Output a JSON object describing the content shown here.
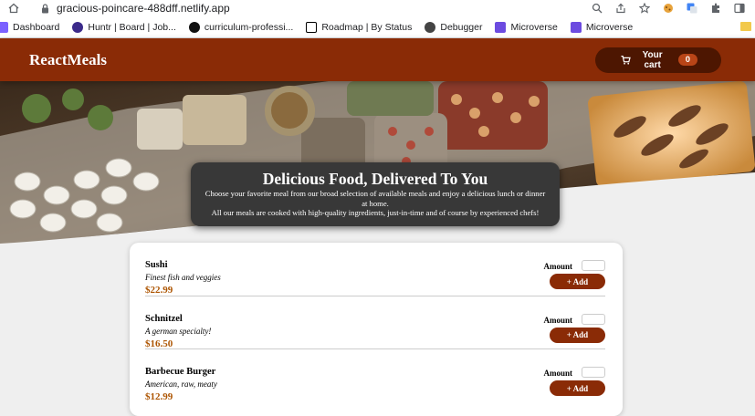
{
  "browser": {
    "url": "gracious-poincare-488dff.netlify.app",
    "bookmarks": [
      {
        "label": "Dashboard",
        "color": "#7b61ff"
      },
      {
        "label": "Huntr | Board | Job...",
        "color": "#3b2a8a"
      },
      {
        "label": "curriculum-professi...",
        "color": "#111111"
      },
      {
        "label": "Roadmap | By Status",
        "color": "#000000"
      },
      {
        "label": "Debugger",
        "color": "#333333"
      },
      {
        "label": "Microverse",
        "color": "#6c4be0"
      },
      {
        "label": "Microverse",
        "color": "#6c4be0"
      }
    ]
  },
  "header": {
    "brand": "ReactMeals",
    "cart_label": "Your cart",
    "cart_count": "0"
  },
  "summary": {
    "title": "Delicious Food, Delivered To You",
    "line1": "Choose your favorite meal from our broad selection of available meals and enjoy a delicious lunch or dinner at home.",
    "line2": "All our meals are cooked with high-quality ingredients, just-in-time and of course by experienced chefs!"
  },
  "meals": [
    {
      "name": "Sushi",
      "description": "Finest fish and veggies",
      "price": "$22.99",
      "amount_label": "Amount",
      "add_label": "+ Add"
    },
    {
      "name": "Schnitzel",
      "description": "A german specialty!",
      "price": "$16.50",
      "amount_label": "Amount",
      "add_label": "+ Add"
    },
    {
      "name": "Barbecue Burger",
      "description": "American, raw, meaty",
      "price": "$12.99",
      "amount_label": "Amount",
      "add_label": "+ Add"
    }
  ],
  "colors": {
    "header": "#8a2b06",
    "cart_button": "#4d1601",
    "badge": "#b94517",
    "price": "#ad5502",
    "summary_bg": "#383838"
  }
}
